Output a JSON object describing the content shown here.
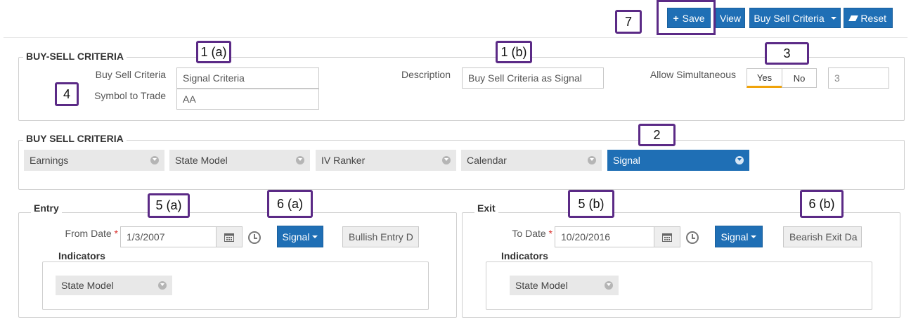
{
  "toolbar": {
    "save_label": "Save",
    "view_label": "View",
    "criteria_label": "Buy Sell Criteria",
    "reset_label": "Reset"
  },
  "section1": {
    "legend": "BUY-SELL CRITERIA",
    "buy_sell_criteria_label": "Buy Sell Criteria",
    "buy_sell_criteria_value": "Signal Criteria",
    "symbol_label": "Symbol to Trade",
    "symbol_value": "AA",
    "description_label": "Description",
    "description_value": "Buy Sell Criteria as Signal",
    "allow_label": "Allow Simultaneous",
    "yes_label": "Yes",
    "no_label": "No",
    "allow_count": "3"
  },
  "section2": {
    "legend": "BUY SELL CRITERIA",
    "tabs": [
      {
        "label": "Earnings"
      },
      {
        "label": "State Model"
      },
      {
        "label": "IV Ranker"
      },
      {
        "label": "Calendar"
      },
      {
        "label": "Signal"
      }
    ],
    "active_tab": "Signal"
  },
  "entry": {
    "legend": "Entry",
    "date_label": "From Date",
    "required_mark": "*",
    "date_value": "1/3/2007",
    "signal_label": "Signal",
    "signal_name": "Bullish Entry D",
    "indicators_legend": "Indicators",
    "indicator": "State Model"
  },
  "exit": {
    "legend": "Exit",
    "date_label": "To Date",
    "required_mark": "*",
    "date_value": "10/20/2016",
    "signal_label": "Signal",
    "signal_name": "Bearish Exit Da",
    "indicators_legend": "Indicators",
    "indicator": "State Model"
  },
  "annotations": {
    "a1a": "1 (a)",
    "a1b": "1 (b)",
    "a2": "2",
    "a3": "3",
    "a4": "4",
    "a5a": "5 (a)",
    "a5b": "5 (b)",
    "a6a": "6 (a)",
    "a6b": "6 (b)",
    "a7": "7"
  },
  "colors": {
    "primary": "#1f6fb5",
    "annotation_border": "#5b2a86",
    "toggle_active": "#f0a30a"
  }
}
